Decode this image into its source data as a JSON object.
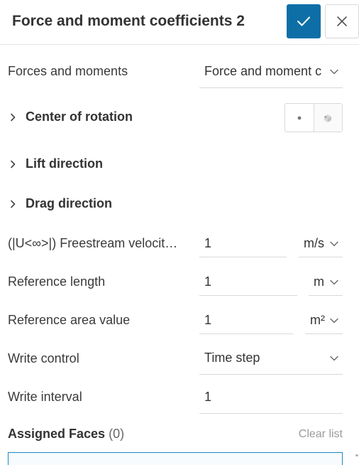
{
  "header": {
    "title": "Force and moment coefficients 2"
  },
  "rows": {
    "forces_moments": {
      "label": "Forces and moments",
      "value": "Force and moment c"
    },
    "center_of_rotation": {
      "label": "Center of rotation"
    },
    "lift_direction": {
      "label": "Lift direction"
    },
    "drag_direction": {
      "label": "Drag direction"
    },
    "freestream_velocity": {
      "label": "(|U<∞>|) Freestream velocit…",
      "value": "1",
      "unit": "m/s"
    },
    "reference_length": {
      "label": "Reference length",
      "value": "1",
      "unit": "m"
    },
    "reference_area": {
      "label": "Reference area value",
      "value": "1",
      "unit": "m²"
    },
    "write_control": {
      "label": "Write control",
      "value": "Time step"
    },
    "write_interval": {
      "label": "Write interval",
      "value": "1"
    }
  },
  "assigned_faces": {
    "label": "Assigned Faces",
    "count": "(0)",
    "clear_label": "Clear list"
  },
  "colors": {
    "accent": "#0e6fa7",
    "faces_border": "#1e88c7"
  },
  "icons": [
    "check-icon",
    "close-icon",
    "chevron-right-icon",
    "chevron-down-icon",
    "point-icon",
    "cube-icon"
  ]
}
